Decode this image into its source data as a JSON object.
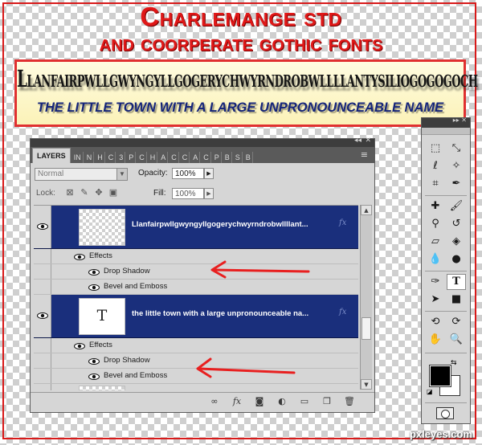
{
  "heading": {
    "line1": "Charlemange std",
    "line2": "and coorperate gothic fonts"
  },
  "banner": {
    "long_name": "Llanfairpwllgwyngyllgogerychwyrndrobwllllantysiliogogogoch",
    "subtitle": "THE LITTLE TOWN WITH A LARGE UNPRONOUNCEABLE NAME"
  },
  "layers_panel": {
    "tabs": [
      "LAYERS",
      "IN",
      "N",
      "H",
      "C",
      "3",
      "P",
      "C",
      "H",
      "A",
      "C",
      "C",
      "A",
      "C",
      "P",
      "B",
      "S",
      "B"
    ],
    "blend_mode": "Normal",
    "opacity_label": "Opacity:",
    "opacity_value": "100%",
    "lock_label": "Lock:",
    "fill_label": "Fill:",
    "fill_value": "100%",
    "layers": [
      {
        "name": "Llanfairpwllgwyngyllgogerychwyrndrobwllllant...",
        "effects_label": "Effects",
        "effects": [
          "Drop Shadow",
          "Bevel and Emboss"
        ]
      },
      {
        "name": "the little town with a large unpronounceable na...",
        "thumb_glyph": "T",
        "effects_label": "Effects",
        "effects": [
          "Drop Shadow",
          "Bevel and Emboss"
        ]
      }
    ],
    "fx_badge": "fx",
    "bottom_icons": [
      "link-icon",
      "fx-icon",
      "mask-icon",
      "adjustment-icon",
      "group-folder-icon",
      "new-layer-icon",
      "trash-icon"
    ]
  },
  "tools_panel": {
    "tools": [
      "marquee-icon",
      "move-icon",
      "lasso-icon",
      "magic-wand-icon",
      "crop-icon",
      "eyedropper-icon",
      "healing-brush-icon",
      "brush-icon",
      "clone-stamp-icon",
      "history-brush-icon",
      "eraser-icon",
      "paint-bucket-icon",
      "blur-icon",
      "dodge-icon",
      "pen-icon",
      "type-icon",
      "path-selection-icon",
      "rectangle-icon",
      "3d-rotate-icon",
      "3d-orbit-icon",
      "hand-icon",
      "zoom-icon"
    ],
    "foreground_color": "#000000",
    "background_color": "#ffffff"
  },
  "colors": {
    "title_red": "#e01818",
    "layer_selected_blue": "#1a2f7c",
    "arrow_red": "#e82020"
  },
  "watermark": "pxleyes.com"
}
